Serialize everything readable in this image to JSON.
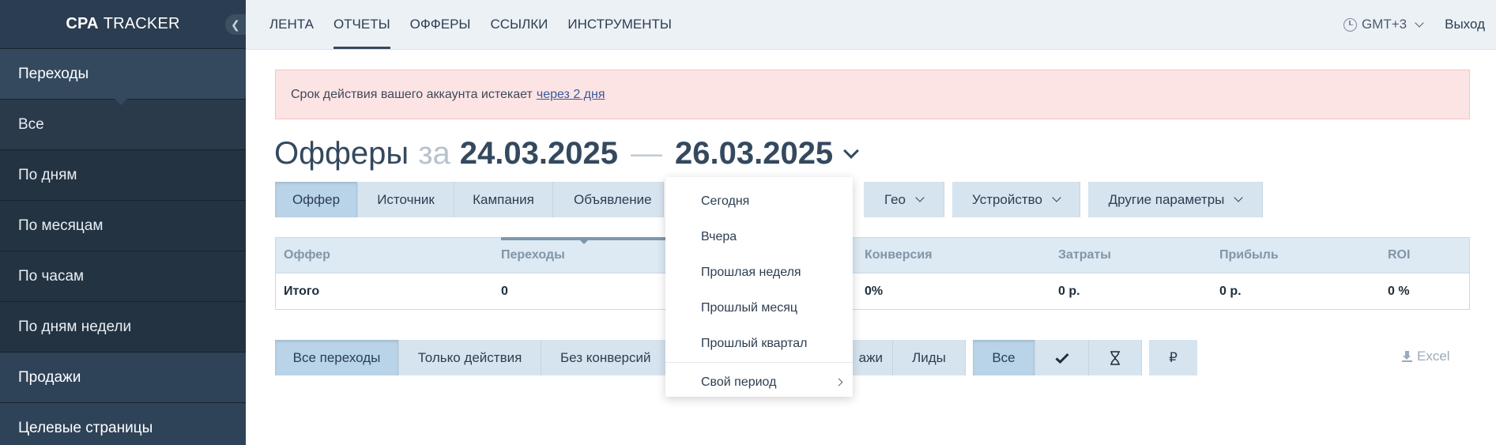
{
  "app": {
    "logo_bold": "CPA",
    "logo_light": "TRACKER"
  },
  "sidebar": {
    "items": [
      {
        "label": "Переходы",
        "type": "section",
        "active": true
      },
      {
        "label": "Все",
        "type": "sub"
      },
      {
        "label": "По дням",
        "type": "sub"
      },
      {
        "label": "По месяцам",
        "type": "sub"
      },
      {
        "label": "По часам",
        "type": "sub"
      },
      {
        "label": "По дням недели",
        "type": "sub"
      },
      {
        "label": "Продажи",
        "type": "section"
      },
      {
        "label": "Целевые страницы",
        "type": "section"
      }
    ]
  },
  "topnav": {
    "items": [
      "ЛЕНТА",
      "ОТЧЕТЫ",
      "ОФФЕРЫ",
      "ССЫЛКИ",
      "ИНСТРУМЕНТЫ"
    ],
    "active_index": 1,
    "timezone": "GMT+3",
    "logout": "Выход"
  },
  "alert": {
    "text": "Срок действия вашего аккаунта истекает",
    "link": "через 2 дня"
  },
  "title": {
    "main": "Офферы",
    "za": "за",
    "date_from": "24.03.2025",
    "dash": "—",
    "date_to": "26.03.2025"
  },
  "group_tabs": {
    "left": [
      "Оффер",
      "Источник",
      "Кампания",
      "Объявление"
    ],
    "geo": "Гео",
    "device": "Устройство",
    "other": "Другие параметры"
  },
  "table": {
    "headers": [
      "Оффер",
      "Переходы",
      "Конверсия",
      "Затраты",
      "Прибыль",
      "ROI"
    ],
    "total_row": [
      "Итого",
      "0",
      "0%",
      "0 р.",
      "0 р.",
      "0 %"
    ]
  },
  "filters": {
    "left": [
      "Все переходы",
      "Только действия",
      "Без конверсий"
    ],
    "mid": [
      "ажи",
      "Лиды"
    ],
    "status": [
      "Все"
    ],
    "currency": "₽",
    "excel": "Excel"
  },
  "date_dropdown": {
    "items": [
      "Сегодня",
      "Вчера",
      "Прошлая неделя",
      "Прошлый месяц",
      "Прошлый квартал"
    ],
    "custom": "Свой период"
  }
}
